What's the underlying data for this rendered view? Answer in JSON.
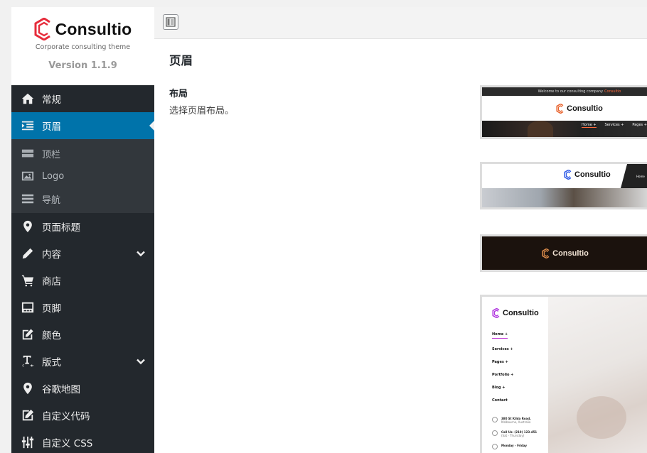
{
  "brand": {
    "name": "Consultio",
    "tagline": "Corporate consulting theme",
    "version": "Version 1.1.9",
    "accent": "#e62b3a"
  },
  "sidebar": {
    "items": [
      {
        "label": "常规",
        "icon": "home-icon"
      },
      {
        "label": "页眉",
        "icon": "header-icon",
        "active": true
      },
      {
        "label": "页面标题",
        "icon": "location-pin-icon"
      },
      {
        "label": "内容",
        "icon": "pencil-icon",
        "expandable": true
      },
      {
        "label": "商店",
        "icon": "cart-icon"
      },
      {
        "label": "页脚",
        "icon": "footer-icon"
      },
      {
        "label": "颜色",
        "icon": "edit-icon"
      },
      {
        "label": "版式",
        "icon": "typography-icon",
        "expandable": true
      },
      {
        "label": "谷歌地图",
        "icon": "location-pin-icon"
      },
      {
        "label": "自定义代码",
        "icon": "edit-box-icon"
      },
      {
        "label": "自定义 CSS",
        "icon": "sliders-icon"
      }
    ],
    "submenu": [
      {
        "label": "顶栏",
        "icon": "topbar-icon"
      },
      {
        "label": "Logo",
        "icon": "image-icon"
      },
      {
        "label": "导航",
        "icon": "menu-icon"
      }
    ],
    "active_color": "#0073aa"
  },
  "main": {
    "title": "页眉",
    "field_label": "布局",
    "field_desc": "选择页眉布局。",
    "options": {
      "opt1": {
        "welcome": "Welcome to our consulting company",
        "welcome_highlight": "Consultio",
        "logo": "Consultio",
        "nav": [
          "Home +",
          "Services +",
          "Pages +"
        ]
      },
      "opt2": {
        "logo": "Consultio",
        "nav_peek": "Home"
      },
      "opt3": {
        "logo": "Consultio"
      },
      "opt4": {
        "logo": "Consultio",
        "nav": [
          "Home +",
          "Services +",
          "Pages +",
          "Portfolio +",
          "Blog +",
          "Contact"
        ],
        "contact": [
          {
            "line1": "380 St Kilda Road,",
            "line2": "Melbourne, Australia"
          },
          {
            "line1": "Call Us: (210) 123-451",
            "line2": "(Sat - Thursday)"
          },
          {
            "line1": "Monday - Friday",
            "line2": ""
          }
        ]
      }
    }
  }
}
